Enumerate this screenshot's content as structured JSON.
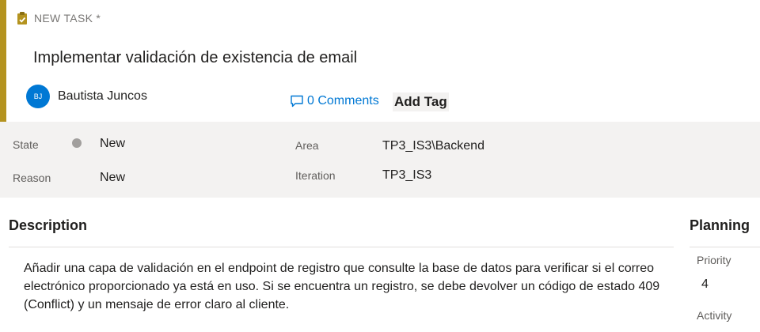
{
  "header": {
    "type_label": "NEW TASK *",
    "title": "Implementar validación de existencia de email",
    "assignee_initials": "BJ",
    "assignee_name": "Bautista Juncos",
    "comments_label": "0 Comments",
    "add_tag_label": "Add Tag"
  },
  "fields": {
    "state_label": "State",
    "state_value": "New",
    "reason_label": "Reason",
    "reason_value": "New",
    "area_label": "Area",
    "area_value": "TP3_IS3\\Backend",
    "iteration_label": "Iteration",
    "iteration_value": "TP3_IS3"
  },
  "description": {
    "title": "Description",
    "text": "Añadir una capa de validación en el endpoint de registro que consulte la base de datos para verificar si el correo electrónico proporcionado ya está en uso. Si se encuentra un registro, se debe devolver un código de estado 409 (Conflict) y un mensaje de error claro al cliente."
  },
  "planning": {
    "title": "Planning",
    "priority_label": "Priority",
    "priority_value": "4",
    "activity_label": "Activity"
  },
  "colors": {
    "accent": "#b4931f",
    "link": "#0078d4",
    "avatar": "#0078d4",
    "state_dot": "#a19f9d"
  },
  "icons": {
    "type_icon": "clipboard-check-icon",
    "comments_icon": "comment-bubble-icon"
  }
}
